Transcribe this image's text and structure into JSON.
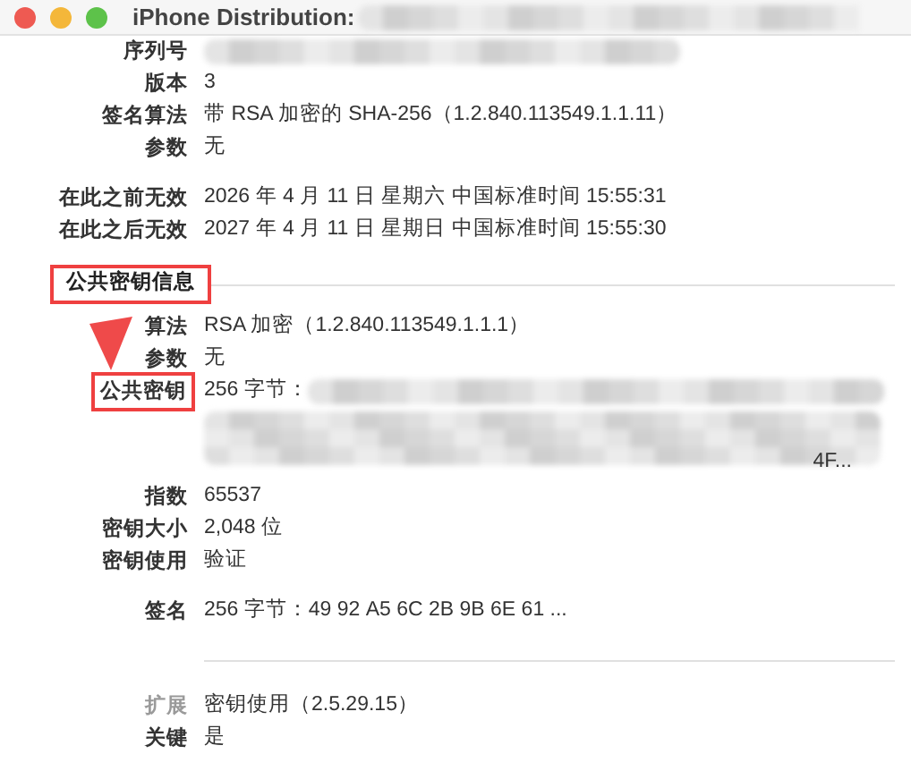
{
  "window": {
    "title": "iPhone Distribution:",
    "title_redacted": true
  },
  "rows": [
    {
      "kind": "field",
      "label": "序列号",
      "value": "",
      "redacted": true,
      "highlighted": false,
      "dimmed": false
    },
    {
      "kind": "field",
      "label": "版本",
      "value": "3",
      "redacted": false,
      "highlighted": false,
      "dimmed": false
    },
    {
      "kind": "field",
      "label": "签名算法",
      "value": "带 RSA 加密的 SHA-256（1.2.840.113549.1.1.11）",
      "redacted": false,
      "highlighted": false,
      "dimmed": false
    },
    {
      "kind": "field",
      "label": "参数",
      "value": "无",
      "redacted": false,
      "highlighted": false,
      "dimmed": false
    },
    {
      "kind": "gap"
    },
    {
      "kind": "field",
      "label": "在此之前无效",
      "value": "2026 年 4 月 11 日 星期六 中国标准时间 15:55:31",
      "redacted": false,
      "highlighted": false,
      "dimmed": false
    },
    {
      "kind": "field",
      "label": "在此之后无效",
      "value": "2027 年 4 月 11 日 星期日 中国标准时间 15:55:30",
      "redacted": false,
      "highlighted": false,
      "dimmed": false
    },
    {
      "kind": "heading",
      "label": "公共密钥信息",
      "highlighted": true
    },
    {
      "kind": "field",
      "label": "算法",
      "value": "RSA 加密（1.2.840.113549.1.1.1）",
      "redacted": false,
      "highlighted": false,
      "dimmed": false
    },
    {
      "kind": "field",
      "label": "参数",
      "value": "无",
      "redacted": false,
      "highlighted": false,
      "dimmed": false
    },
    {
      "kind": "field",
      "label": "公共密钥",
      "value": "256 字节：",
      "redacted": true,
      "tail": "4F...",
      "highlighted": true,
      "dimmed": false
    },
    {
      "kind": "field",
      "label": "指数",
      "value": "65537",
      "redacted": false,
      "highlighted": false,
      "dimmed": false
    },
    {
      "kind": "field",
      "label": "密钥大小",
      "value": "2,048 位",
      "redacted": false,
      "highlighted": false,
      "dimmed": false
    },
    {
      "kind": "field",
      "label": "密钥使用",
      "value": "验证",
      "redacted": false,
      "highlighted": false,
      "dimmed": false
    },
    {
      "kind": "gap"
    },
    {
      "kind": "field",
      "label": "签名",
      "value": "256 字节：49 92 A5 6C 2B 9B 6E 61 ...",
      "redacted": false,
      "highlighted": false,
      "dimmed": false
    },
    {
      "kind": "rule"
    },
    {
      "kind": "field",
      "label": "扩展",
      "value": "密钥使用（2.5.29.15）",
      "redacted": false,
      "highlighted": false,
      "dimmed": true
    },
    {
      "kind": "field",
      "label": "关键",
      "value": "是",
      "redacted": false,
      "highlighted": false,
      "dimmed": false
    }
  ],
  "annotation": {
    "arrow": true
  }
}
